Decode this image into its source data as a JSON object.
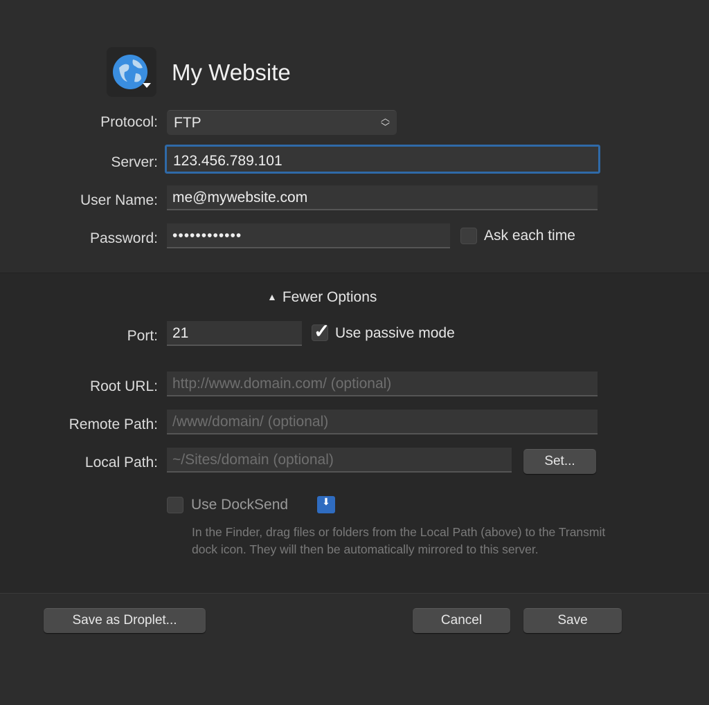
{
  "header": {
    "title": "My Website",
    "icon": "globe-icon"
  },
  "form": {
    "protocol_label": "Protocol:",
    "protocol_value": "FTP",
    "server_label": "Server:",
    "server_value": "123.456.789.101",
    "username_label": "User Name:",
    "username_value": "me@mywebsite.com",
    "password_label": "Password:",
    "password_value": "••••••••••••",
    "ask_each_time": "Ask each time"
  },
  "options": {
    "toggle_label": "Fewer Options",
    "port_label": "Port:",
    "port_value": "21",
    "passive_label": "Use passive mode",
    "passive_checked": true,
    "root_url_label": "Root URL:",
    "root_url_placeholder": "http://www.domain.com/ (optional)",
    "remote_path_label": "Remote Path:",
    "remote_path_placeholder": "/www/domain/ (optional)",
    "local_path_label": "Local Path:",
    "local_path_placeholder": "~/Sites/domain (optional)",
    "set_button": "Set...",
    "docksend_label": "Use DockSend",
    "docksend_help": "In the Finder, drag files or folders from the Local Path (above) to the Transmit dock icon. They will then be automatically mirrored to this server."
  },
  "footer": {
    "droplet": "Save as Droplet...",
    "cancel": "Cancel",
    "save": "Save"
  },
  "colors": {
    "focus": "#2f6aa8",
    "bg": "#2d2d2d",
    "section_bg": "#282828"
  }
}
